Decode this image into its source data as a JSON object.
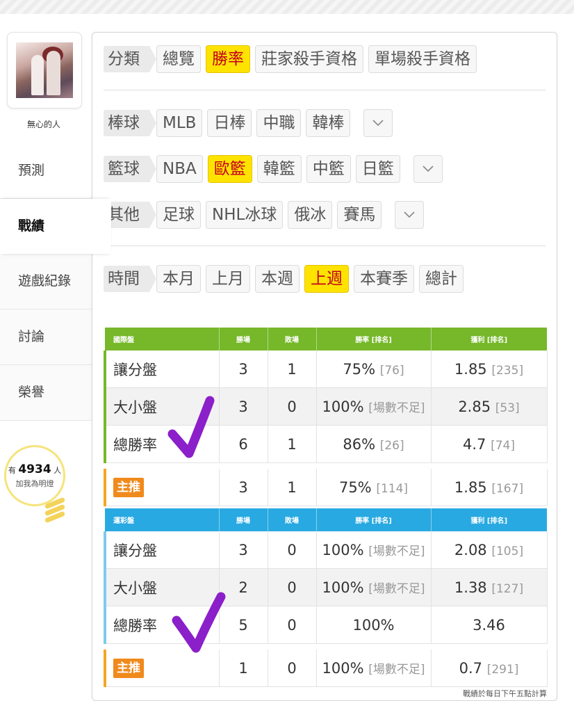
{
  "sidebar": {
    "username": "無心的人",
    "nav": [
      "預測",
      "戰績",
      "遊戲紀錄",
      "討論",
      "榮譽"
    ],
    "lamp": {
      "prefix": "有",
      "count": "4934",
      "suffix": "人",
      "caption": "加我為明燈"
    }
  },
  "filters": {
    "category": {
      "label": "分類",
      "items": [
        "總覽",
        "勝率",
        "莊家殺手資格",
        "單場殺手資格"
      ],
      "active": "勝率"
    },
    "baseball": {
      "label": "棒球",
      "items": [
        "MLB",
        "日棒",
        "中職",
        "韓棒"
      ]
    },
    "basketball": {
      "label": "籃球",
      "items": [
        "NBA",
        "歐籃",
        "韓籃",
        "中籃",
        "日籃"
      ],
      "active": "歐籃"
    },
    "other": {
      "label": "其他",
      "items": [
        "足球",
        "NHL冰球",
        "俄冰",
        "賽馬"
      ]
    },
    "time": {
      "label": "時間",
      "items": [
        "本月",
        "上月",
        "本週",
        "上週",
        "本賽季",
        "總計"
      ],
      "active": "上週"
    }
  },
  "tables": {
    "international": {
      "headers": [
        "國際盤",
        "勝場",
        "敗場",
        "勝率 [排名]",
        "獲利 [排名]"
      ],
      "rows": [
        {
          "name": "讓分盤",
          "win": "3",
          "loss": "1",
          "rate": "75%",
          "rate_rank": "[76]",
          "profit": "1.85",
          "profit_rank": "[235]"
        },
        {
          "name": "大小盤",
          "win": "3",
          "loss": "0",
          "rate": "100%",
          "rate_rank": "[場數不足]",
          "profit": "2.85",
          "profit_rank": "[53]"
        },
        {
          "name": "總勝率",
          "win": "6",
          "loss": "1",
          "rate": "86%",
          "rate_rank": "[26]",
          "profit": "4.7",
          "profit_rank": "[74]"
        }
      ],
      "pick": {
        "name": "主推",
        "win": "3",
        "loss": "1",
        "rate": "75%",
        "rate_rank": "[114]",
        "profit": "1.85",
        "profit_rank": "[167]"
      }
    },
    "lottery": {
      "headers": [
        "運彩盤",
        "勝場",
        "敗場",
        "勝率 [排名]",
        "獲利 [排名]"
      ],
      "rows": [
        {
          "name": "讓分盤",
          "win": "3",
          "loss": "0",
          "rate": "100%",
          "rate_rank": "[場數不足]",
          "profit": "2.08",
          "profit_rank": "[105]"
        },
        {
          "name": "大小盤",
          "win": "2",
          "loss": "0",
          "rate": "100%",
          "rate_rank": "[場數不足]",
          "profit": "1.38",
          "profit_rank": "[127]"
        },
        {
          "name": "總勝率",
          "win": "5",
          "loss": "0",
          "rate": "100%",
          "rate_rank": "",
          "profit": "3.46",
          "profit_rank": ""
        }
      ],
      "pick": {
        "name": "主推",
        "win": "1",
        "loss": "0",
        "rate": "100%",
        "rate_rank": "[場數不足]",
        "profit": "0.7",
        "profit_rank": "[291]"
      }
    }
  },
  "note": "戰績於每日下午五點計算",
  "colors": {
    "active_tag": "#ffe300",
    "intl_header": "#76b82a",
    "lottery_header": "#29a9e1",
    "pick_badge": "#f08a1d",
    "checkmark": "#8b1fc9"
  }
}
